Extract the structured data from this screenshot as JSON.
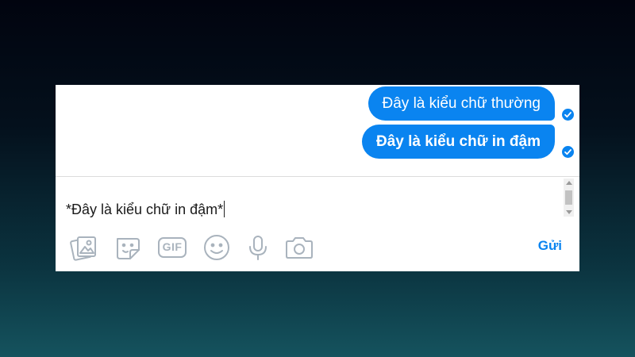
{
  "messages": [
    {
      "text": "Đây là kiểu chữ thường",
      "style": "normal"
    },
    {
      "text": "Đây là kiểu chữ in đậm",
      "style": "bold"
    }
  ],
  "composer": {
    "input_value": "*Đây là kiểu chữ in đậm*"
  },
  "toolbar": {
    "icons": [
      "photo-icon",
      "sticker-icon",
      "gif-icon",
      "emoji-icon",
      "microphone-icon",
      "camera-icon"
    ],
    "gif_label": "GIF",
    "send_label": "Gửi"
  },
  "colors": {
    "accent": "#0a84f0",
    "icon_gray": "#a9b3bd",
    "bubble_text": "#ffffff"
  }
}
